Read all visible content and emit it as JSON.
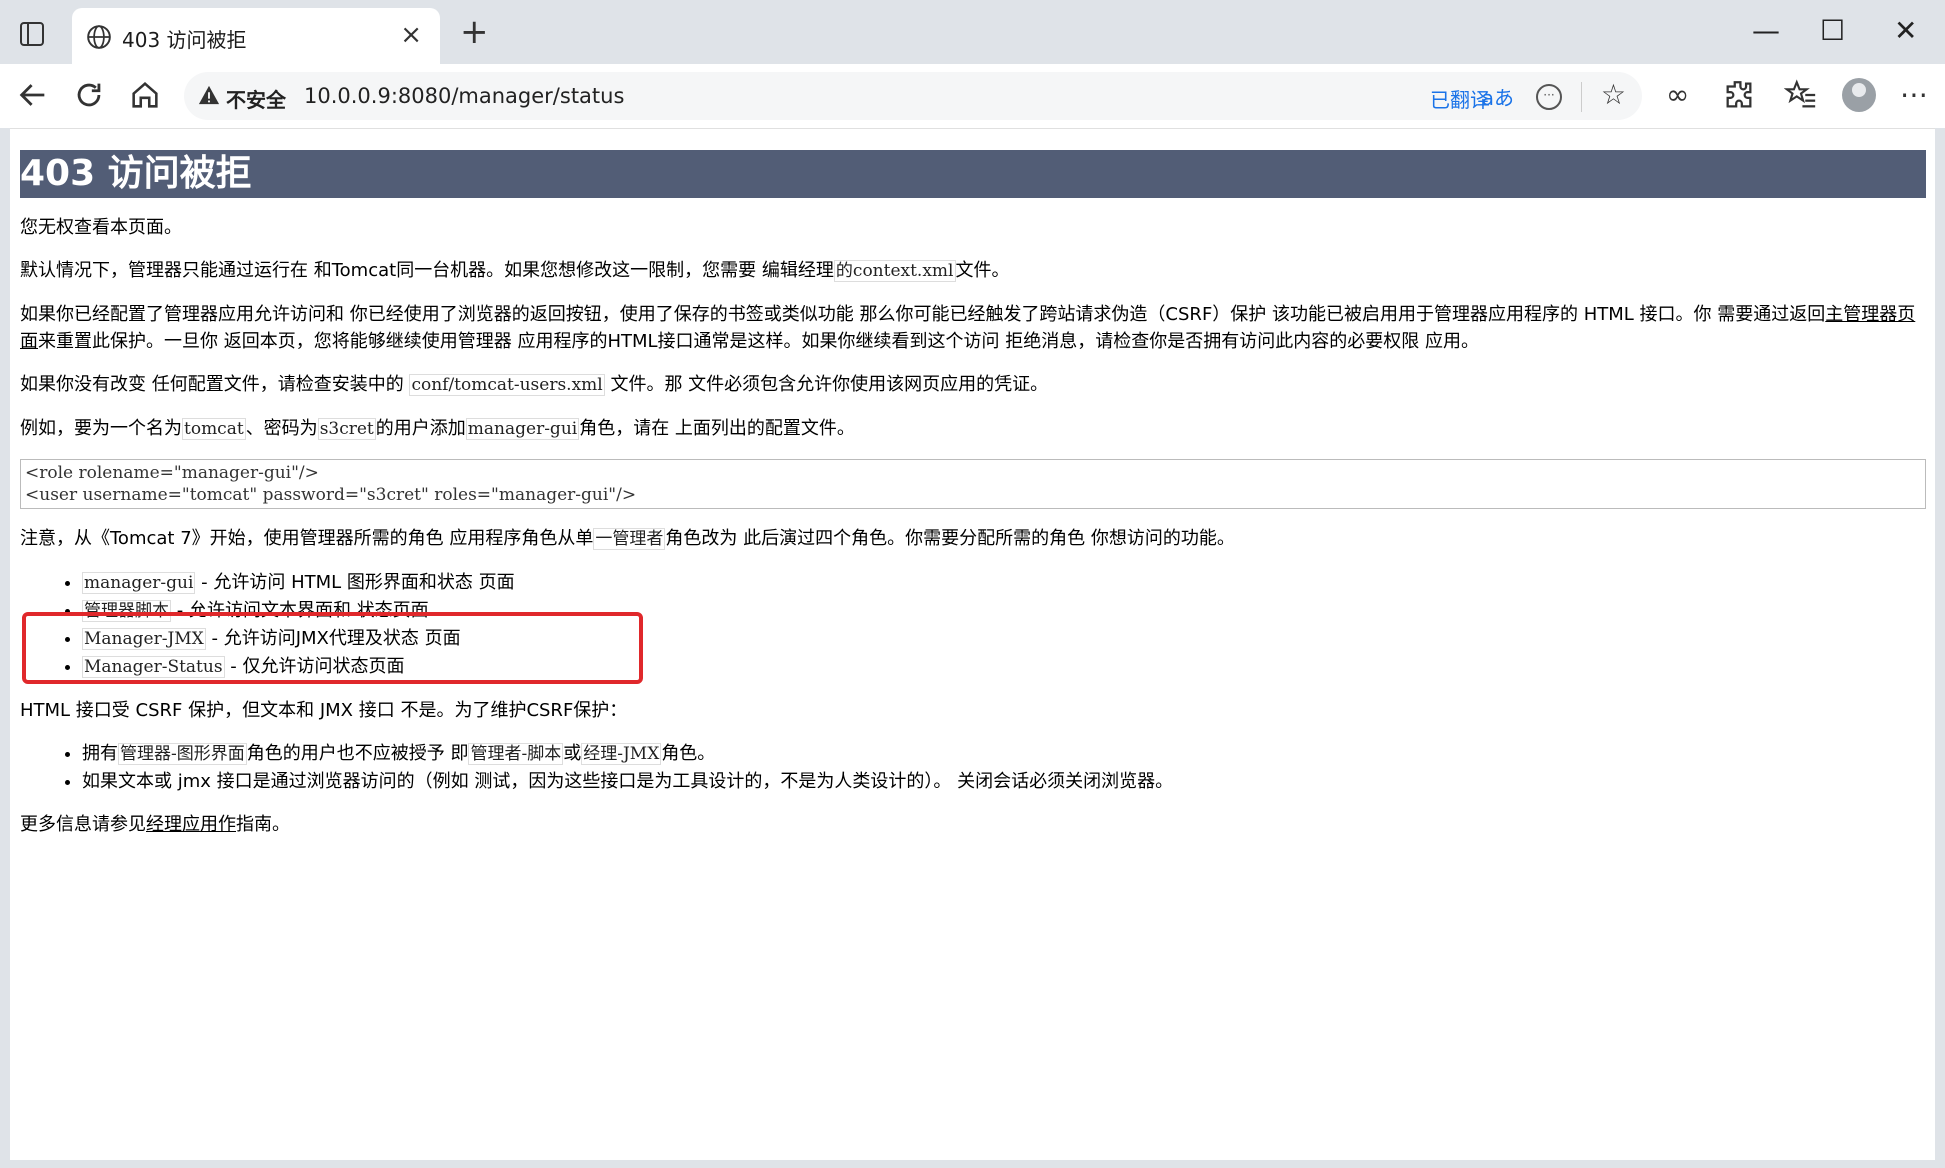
{
  "browser": {
    "tab_title": "403 访问被拒",
    "new_tab": "+",
    "tab_close": "×",
    "window": {
      "minimize": "—",
      "maximize": "☐",
      "close": "✕"
    },
    "address": {
      "security_label": "不安全",
      "url": "10.0.0.9:8080/manager/status",
      "translated_label": "已翻译",
      "translate_icon_text": "aあ"
    }
  },
  "page": {
    "heading": "403 访问被拒",
    "p1": "您无权查看本页面。",
    "p2": {
      "text": "默认情况下，管理器只能通过运行在 和Tomcat同一台机器。如果您想修改这一限制，您需要 编辑经理",
      "code": "的context.xml",
      "tail": "文件。"
    },
    "p3": {
      "text": "如果你已经配置了管理器应用允许访问和 你已经使用了浏览器的返回按钮，使用了保存的书签或类似功能 那么你可能已经触发了跨站请求伪造（CSRF）保护 该功能已被启用用于管理器应用程序的 HTML 接口。你 需要通过返回",
      "link": "主管理器页面",
      "tail": "来重置此保护。一旦你 返回本页，您将能够继续使用管理器 应用程序的HTML接口通常是这样。如果你继续看到这个访问 拒绝消息，请检查你是否拥有访问此内容的必要权限 应用。"
    },
    "p4": {
      "text": "如果你没有改变 任何配置文件，请检查安装中的 ",
      "code": "conf/tomcat-users.xml",
      "tail": " 文件。那 文件必须包含允许你使用该网页应用的凭证。"
    },
    "p5": {
      "a": "例如，要为一个名为",
      "code1": "tomcat",
      "b": "、密码为",
      "code2": "s3cret",
      "c": "的用户添加",
      "code3": "manager-gui",
      "d": "角色，请在 上面列出的配置文件。"
    },
    "code_line1": "<role rolename=\"manager-gui\"/>",
    "code_line2": "<user username=\"tomcat\" password=\"s3cret\" roles=\"manager-gui\"/>",
    "p6": {
      "a": "注意，从《Tomcat 7》开始，使用管理器所需的角色 应用程序角色从单",
      "code": "一管理者",
      "b": "角色改为 此后演过四个角色。你需要分配所需的角色 你想访问的功能。"
    },
    "roles": [
      {
        "code": "manager-gui",
        "desc": " - 允许访问 HTML 图形界面和状态 页面"
      },
      {
        "code": "管理器脚本",
        "desc": " - 允许访问文本界面和 状态页面"
      },
      {
        "code": "Manager-JMX",
        "desc": " - 允许访问JMX代理及状态 页面"
      },
      {
        "code": "Manager-Status",
        "desc": " - 仅允许访问状态页面"
      }
    ],
    "p7": "HTML 接口受 CSRF 保护，但文本和 JMX 接口 不是。为了维护CSRF保护：",
    "csrf": {
      "item1": {
        "a": "拥有",
        "code1": "管理器-图形界面",
        "b": "角色的用户也不应被授予 即",
        "code2": "管理者-脚本",
        "c": "或",
        "code3": "经理-JMX",
        "d": "角色。"
      },
      "item2": "如果文本或 jmx 接口是通过浏览器访问的（例如 测试，因为这些接口是为工具设计的，不是为人类设计的）。 关闭会话必须关闭浏览器。"
    },
    "p8": {
      "a": "更多信息请参见",
      "link": "经理应用作",
      "b": "指南。"
    }
  }
}
